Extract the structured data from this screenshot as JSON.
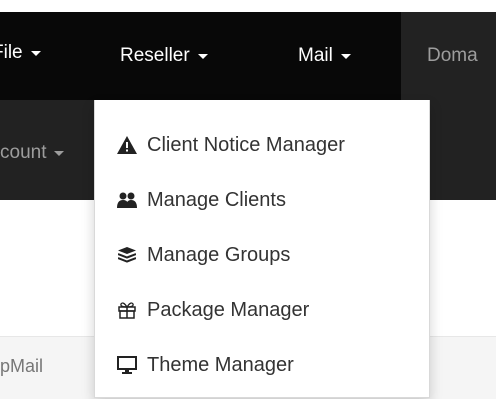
{
  "nav": {
    "file_label": "File",
    "reseller_label": "Reseller",
    "mail_label": "Mail",
    "domains_label": "Doma",
    "account_label": "count"
  },
  "reseller_menu": {
    "items": [
      {
        "label": "Client Notice Manager",
        "icon": "warning-icon"
      },
      {
        "label": "Manage Clients",
        "icon": "users-icon"
      },
      {
        "label": "Manage Groups",
        "icon": "layers-icon"
      },
      {
        "label": "Package Manager",
        "icon": "gift-icon"
      },
      {
        "label": "Theme Manager",
        "icon": "monitor-icon"
      }
    ]
  },
  "breadcrumb": {
    "text": "pMail"
  },
  "colors": {
    "navbar": "#222222",
    "navbar_active": "#080808",
    "nav_text": "#ffffff",
    "nav_text_dim": "#9d9d9d",
    "menu_text": "#333333"
  }
}
